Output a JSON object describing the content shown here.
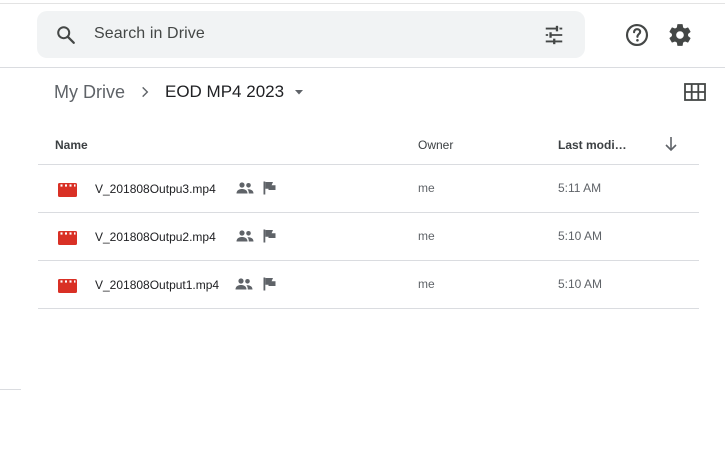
{
  "search": {
    "placeholder": "Search in Drive",
    "icon": "search-icon",
    "filter_icon": "tune-icon"
  },
  "header": {
    "help_icon": "help-icon",
    "settings_icon": "gear-icon"
  },
  "breadcrumb": {
    "root": "My Drive",
    "current": "EOD MP4 2023"
  },
  "table": {
    "columns": {
      "name": "Name",
      "owner": "Owner",
      "modified": "Last modi…"
    },
    "sort_direction": "descending",
    "rows": [
      {
        "name": "V_201808Outpu3.mp4",
        "owner": "me",
        "modified": "5:11 AM"
      },
      {
        "name": "V_201808Outpu2.mp4",
        "owner": "me",
        "modified": "5:10 AM"
      },
      {
        "name": "V_201808Output1.mp4",
        "owner": "me",
        "modified": "5:10 AM"
      }
    ]
  },
  "colors": {
    "accent_video": "#d93025",
    "search_bg": "#f1f3f4",
    "divider": "#dadce0",
    "icon_gray": "#5f6368"
  }
}
